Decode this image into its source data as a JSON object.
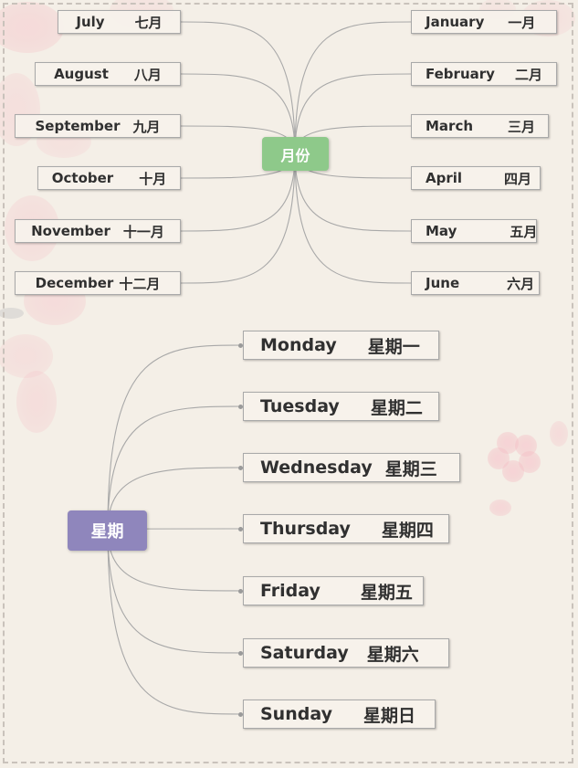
{
  "months": {
    "hub": "月份",
    "left": [
      {
        "en": "July",
        "zh": "七月"
      },
      {
        "en": "August",
        "zh": "八月"
      },
      {
        "en": "September",
        "zh": "九月"
      },
      {
        "en": "October",
        "zh": "十月"
      },
      {
        "en": "November",
        "zh": "十一月"
      },
      {
        "en": "December",
        "zh": "十二月"
      }
    ],
    "right": [
      {
        "en": "January",
        "zh": "一月"
      },
      {
        "en": "February",
        "zh": "二月"
      },
      {
        "en": "March",
        "zh": "三月"
      },
      {
        "en": "April",
        "zh": "四月"
      },
      {
        "en": "May",
        "zh": "五月"
      },
      {
        "en": "June",
        "zh": "六月"
      }
    ]
  },
  "weekdays": {
    "hub": "星期",
    "items": [
      {
        "en": "Monday",
        "zh": "星期一"
      },
      {
        "en": "Tuesday",
        "zh": "星期二"
      },
      {
        "en": "Wednesday",
        "zh": "星期三"
      },
      {
        "en": "Thursday",
        "zh": "星期四"
      },
      {
        "en": "Friday",
        "zh": "星期五"
      },
      {
        "en": "Saturday",
        "zh": "星期六"
      },
      {
        "en": "Sunday",
        "zh": "星期日"
      }
    ]
  },
  "colors": {
    "month_hub": "#8ec98a",
    "week_hub": "#8f86bc",
    "blossom": "#f3b4bd"
  },
  "decorations": [
    "cherry-blossom-icon"
  ]
}
